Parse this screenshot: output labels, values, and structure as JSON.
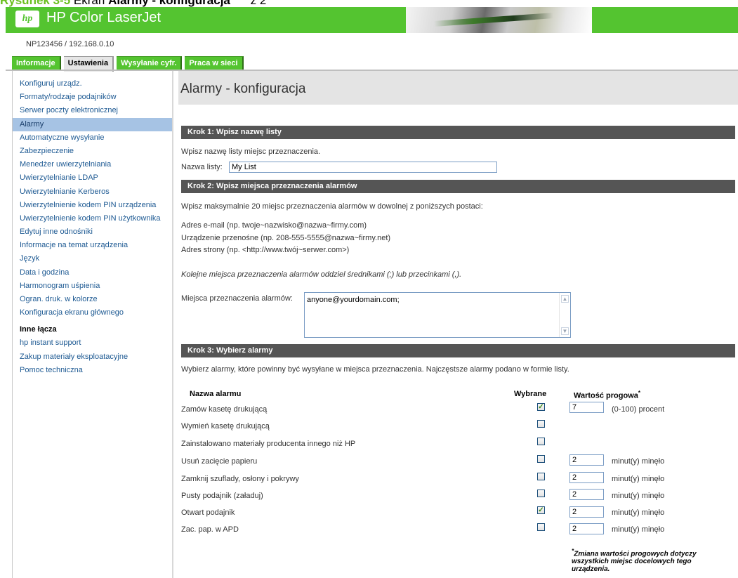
{
  "caption": {
    "figure": "Rysunek 3-5",
    "title_plain": "Ekran",
    "title_bold": "Alarmy - konfiguracja",
    "suffix": "z 2"
  },
  "header": {
    "logo_text": "hp",
    "product": "HP Color LaserJet"
  },
  "device_id": "NP123456 / 192.168.0.10",
  "tabs": [
    {
      "label": "Informacje"
    },
    {
      "label": "Ustawienia"
    },
    {
      "label": "Wysyłanie cyfr."
    },
    {
      "label": "Praca w sieci"
    }
  ],
  "sidebar": {
    "items": [
      {
        "label": "Konfiguruj urządz."
      },
      {
        "label": "Formaty/rodzaje podajników"
      },
      {
        "label": "Serwer poczty elektronicznej"
      },
      {
        "label": "Alarmy"
      },
      {
        "label": "Automatyczne wysyłanie"
      },
      {
        "label": "Zabezpieczenie"
      },
      {
        "label": "Menedżer uwierzytelniania"
      },
      {
        "label": "Uwierzytelnianie LDAP"
      },
      {
        "label": "Uwierzytelnianie Kerberos"
      },
      {
        "label": "Uwierzytelnienie kodem PIN urządzenia"
      },
      {
        "label": "Uwierzytelnienie kodem PIN użytkownika"
      },
      {
        "label": "Edytuj inne odnośniki"
      },
      {
        "label": "Informacje na temat urządzenia"
      },
      {
        "label": "Język"
      },
      {
        "label": "Data i godzina"
      },
      {
        "label": "Harmonogram uśpienia"
      },
      {
        "label": "Ogran. druk. w kolorze"
      },
      {
        "label": "Konfiguracja ekranu głównego"
      }
    ],
    "other_heading": "Inne łącza",
    "other_links": [
      {
        "label": "hp instant support"
      },
      {
        "label": "Zakup materiały eksploatacyjne"
      },
      {
        "label": "Pomoc techniczna"
      }
    ]
  },
  "main": {
    "title": "Alarmy - konfiguracja",
    "step1": {
      "heading": "Krok 1: Wpisz nazwę listy",
      "instruction": "Wpisz nazwę listy miejsc przeznaczenia.",
      "list_label": "Nazwa listy:",
      "list_value": "My List"
    },
    "step2": {
      "heading": "Krok 2: Wpisz miejsca przeznaczenia alarmów",
      "instruction": "Wpisz maksymalnie 20 miejsc przeznaczenia alarmów w dowolnej z poniższych postaci:",
      "formats": [
        "Adres e-mail (np. twoje~nazwisko@nazwa~firmy.com)",
        "Urządzenie przenośne (np. 208-555-5555@nazwa~firmy.net)",
        "Adres strony (np. <http://www.twój~serwer.com>)"
      ],
      "separator_note": "Kolejne miejsca przeznaczenia alarmów oddziel średnikami (;) lub przecinkami (,).",
      "dest_label": "Miejsca przeznaczenia alarmów:",
      "dest_value": "anyone@yourdomain.com;"
    },
    "step3": {
      "heading": "Krok 3: Wybierz alarmy",
      "instruction": "Wybierz alarmy, które powinny być wysyłane w miejsca przeznaczenia. Najczęstsze alarmy podano w formie listy.",
      "col_name": "Nazwa alarmu",
      "col_selected": "Wybrane",
      "col_threshold": "Wartość progowa",
      "col_threshold_mark": "*",
      "alerts": [
        {
          "name": "Zamów kasetę drukującą",
          "selected": true,
          "threshold": "7",
          "unit": "(0-100) procent"
        },
        {
          "name": "Wymień kasetę drukującą",
          "selected": false,
          "threshold": "",
          "unit": ""
        },
        {
          "name": "Zainstalowano materiały producenta innego niż HP",
          "selected": false,
          "threshold": "",
          "unit": ""
        },
        {
          "name": "Usuń zacięcie papieru",
          "selected": false,
          "threshold": "2",
          "unit": "minut(y) minęło"
        },
        {
          "name": "Zamknij szuflady, osłony i pokrywy",
          "selected": false,
          "threshold": "2",
          "unit": "minut(y) minęło"
        },
        {
          "name": "Pusty podajnik (załaduj)",
          "selected": false,
          "threshold": "2",
          "unit": "minut(y) minęło"
        },
        {
          "name": "Otwart podajnik",
          "selected": true,
          "threshold": "2",
          "unit": "minut(y) minęło"
        },
        {
          "name": "Zac. pap. w APD",
          "selected": false,
          "threshold": "2",
          "unit": "minut(y) minęło"
        }
      ],
      "footnote_mark": "*",
      "footnote": "Zmiana wartości progowych dotyczy wszystkich miejsc docelowych tego urządzenia."
    }
  },
  "colors": {
    "brand_green": "#54c430",
    "section_bar": "#555555",
    "nav_link": "#1e5a93",
    "nav_selected": "#a6c3e4"
  }
}
